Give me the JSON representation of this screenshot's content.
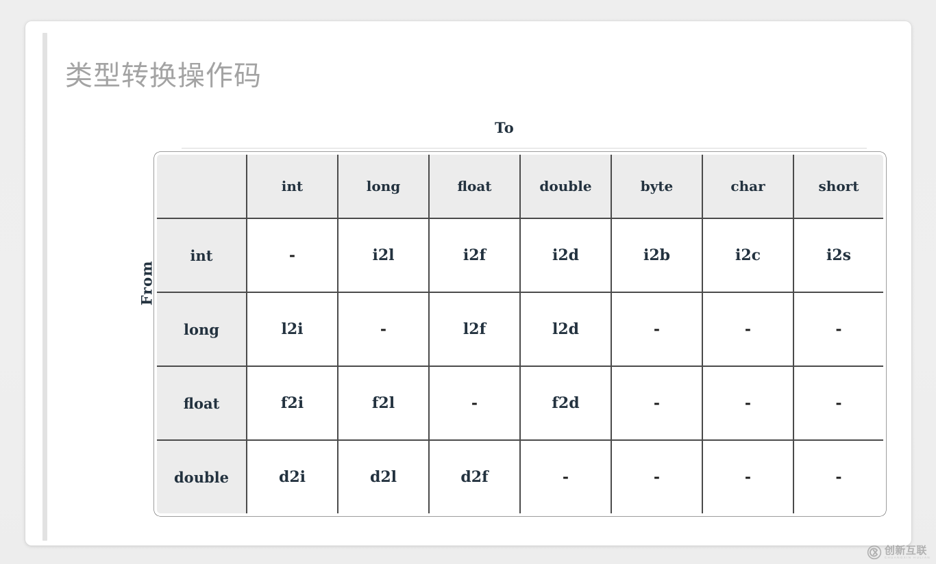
{
  "page": {
    "title": "类型转换操作码",
    "background_color": "#eeeeee",
    "card_color": "#ffffff",
    "accent_rail_color": "#e2e2e2",
    "title_color": "#a3a3a3"
  },
  "figure": {
    "axis_caption_to": "To",
    "axis_caption_from": "From",
    "corner_cell": "",
    "header_fill": "#ececec",
    "cell_fill": "#ffffff",
    "border_color": "#3b3b3b",
    "text_color": "#23323f"
  },
  "chart_data": {
    "type": "table",
    "title": "类型转换操作码",
    "xlabel": "To",
    "ylabel": "From",
    "columns": [
      "",
      "int",
      "long",
      "float",
      "double",
      "byte",
      "char",
      "short"
    ],
    "rows": [
      {
        "label": "int",
        "cells": [
          "-",
          "i2l",
          "i2f",
          "i2d",
          "i2b",
          "i2c",
          "i2s"
        ]
      },
      {
        "label": "long",
        "cells": [
          "l2i",
          "-",
          "l2f",
          "l2d",
          "-",
          "-",
          "-"
        ]
      },
      {
        "label": "float",
        "cells": [
          "f2i",
          "f2l",
          "-",
          "f2d",
          "-",
          "-",
          "-"
        ]
      },
      {
        "label": "double",
        "cells": [
          "d2i",
          "d2l",
          "d2f",
          "-",
          "-",
          "-",
          "-"
        ]
      }
    ]
  },
  "watermark": {
    "mark": "cx-logo-icon",
    "name_cn": "创新互联",
    "name_en": "CHUANGXIN HULIAN"
  }
}
